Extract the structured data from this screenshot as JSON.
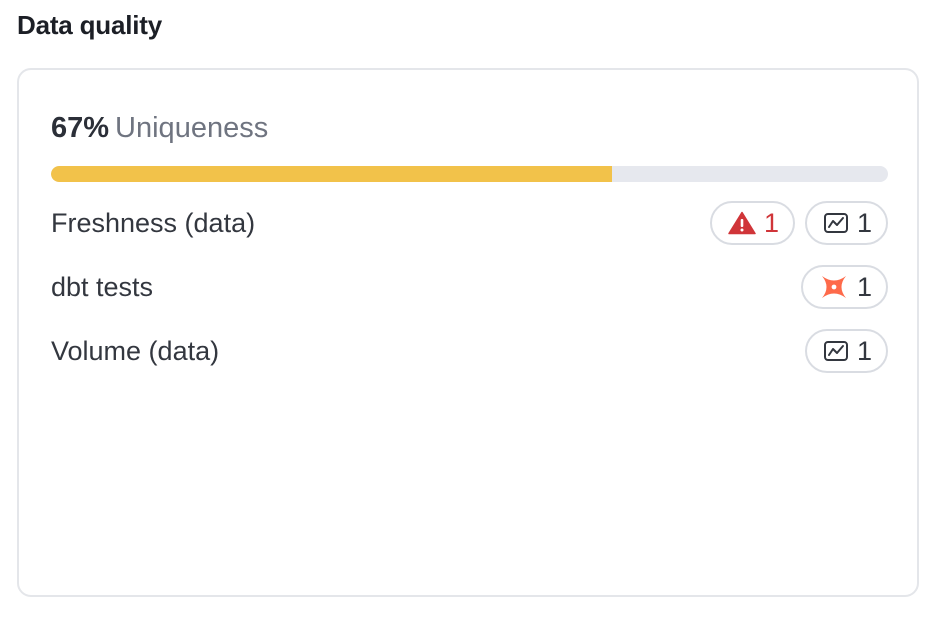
{
  "section": {
    "title": "Data quality"
  },
  "metric": {
    "percent": "67%",
    "label": "Uniqueness",
    "progress": 0.67
  },
  "colors": {
    "progress_fill": "#f2c24a",
    "progress_track": "#e6e8ee",
    "alert": "#d03539",
    "dbt": "#fe6a4a"
  },
  "rows": [
    {
      "label": "Freshness (data)",
      "badges": [
        {
          "icon": "warning-triangle-icon",
          "count": "1"
        },
        {
          "icon": "monitor-chart-icon",
          "count": "1"
        }
      ]
    },
    {
      "label": "dbt tests",
      "badges": [
        {
          "icon": "dbt-logo-icon",
          "count": "1"
        }
      ]
    },
    {
      "label": "Volume (data)",
      "badges": [
        {
          "icon": "monitor-chart-icon",
          "count": "1"
        }
      ]
    }
  ]
}
